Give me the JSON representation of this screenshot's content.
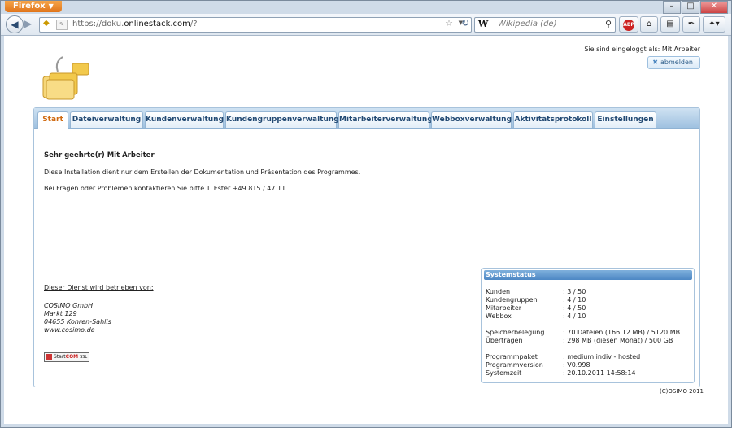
{
  "browser": {
    "app_button": "Firefox",
    "url_prefix": "https://doku.",
    "url_domain": "onlinestack.com",
    "url_suffix": "/?",
    "search_engine": "W",
    "search_placeholder": "Wikipedia (de)"
  },
  "header": {
    "login_info": "Sie sind eingeloggt als: Mit Arbeiter",
    "logout_label": "abmelden"
  },
  "tabs": [
    {
      "label": "Start"
    },
    {
      "label": "Dateiverwaltung"
    },
    {
      "label": "Kundenverwaltung"
    },
    {
      "label": "Kundengruppenverwaltung"
    },
    {
      "label": "Mitarbeiterverwaltung"
    },
    {
      "label": "Webboxverwaltung"
    },
    {
      "label": "Aktivitätsprotokoll"
    },
    {
      "label": "Einstellungen"
    }
  ],
  "content": {
    "greeting": "Sehr geehrte(r) Mit Arbeiter",
    "paragraph1": "Diese Installation dient nur dem Erstellen der Dokumentation und Präsentation des Programmes.",
    "paragraph2": "Bei Fragen oder Problemen kontaktieren Sie bitte T. Ester +49 815 / 47 11.",
    "operator_title": "Dieser Dienst wird betrieben von:",
    "operator_lines": [
      "COSIMO GmbH",
      "Markt 129",
      "04655 Kohren-Sahlis",
      "www.cosimo.de"
    ],
    "badge_start": "Start",
    "badge_com": "COM",
    "badge_ssl": "SSL"
  },
  "systemstatus": {
    "title": "Systemstatus",
    "rows": [
      {
        "label": "Kunden",
        "value": ": 3 / 50"
      },
      {
        "label": "Kundengruppen",
        "value": ": 4 / 10"
      },
      {
        "label": "Mitarbeiter",
        "value": ": 4 / 50"
      },
      {
        "label": "Webbox",
        "value": ": 4 / 10"
      },
      {
        "label": "Speicherbelegung",
        "value": ": 70 Dateien (166.12 MB) / 5120 MB"
      },
      {
        "label": "Übertragen",
        "value": ": 298 MB (diesen Monat) / 500 GB"
      },
      {
        "label": "Programmpaket",
        "value": ": medium indiv - hosted"
      },
      {
        "label": "Programmversion",
        "value": ": V0.998"
      },
      {
        "label": "Systemzeit",
        "value": ": 20.10.2011 14:58:14"
      }
    ]
  },
  "footer": {
    "copyright": "(C)OSIMO 2011"
  },
  "colors": {
    "active_tab": "#d06a10",
    "tab_text": "#234a73",
    "panel_border": "#a8c3dc"
  }
}
